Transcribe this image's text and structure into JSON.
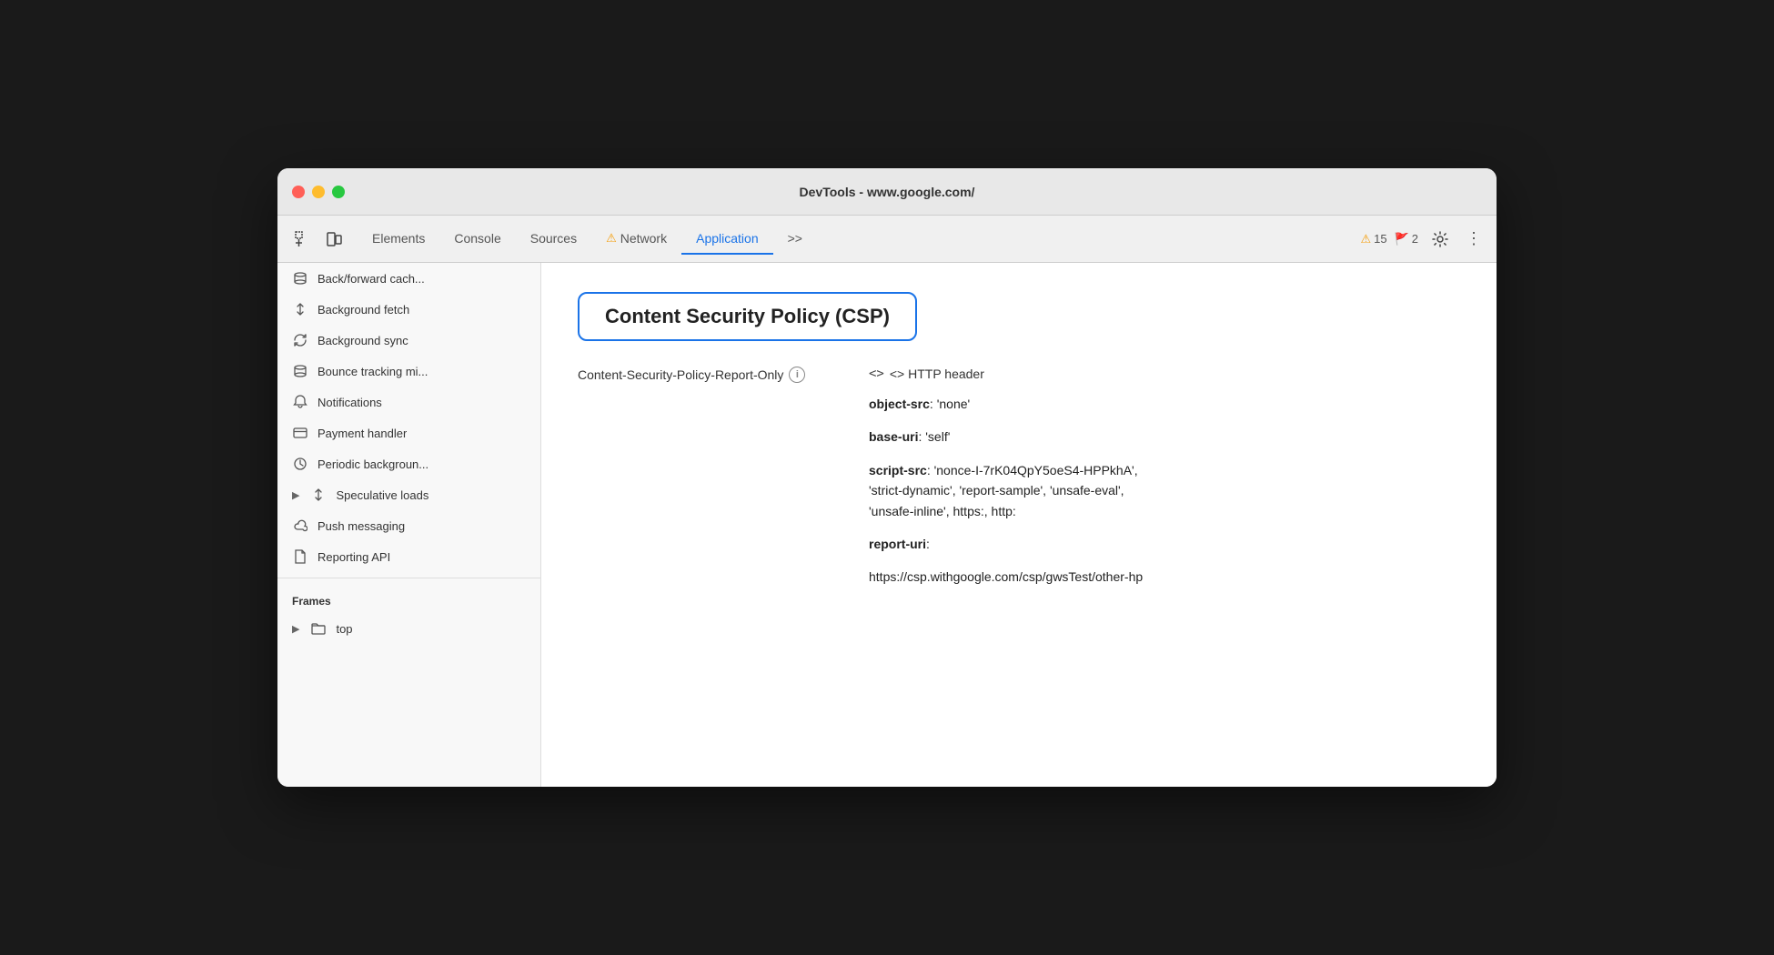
{
  "window": {
    "title": "DevTools - www.google.com/"
  },
  "toolbar": {
    "tabs": [
      {
        "id": "elements",
        "label": "Elements",
        "active": false,
        "warning": false
      },
      {
        "id": "console",
        "label": "Console",
        "active": false,
        "warning": false
      },
      {
        "id": "sources",
        "label": "Sources",
        "active": false,
        "warning": false
      },
      {
        "id": "network",
        "label": "Network",
        "active": false,
        "warning": true
      },
      {
        "id": "application",
        "label": "Application",
        "active": true,
        "warning": false
      }
    ],
    "more_label": ">>",
    "warning_count": "15",
    "error_count": "2"
  },
  "sidebar": {
    "items": [
      {
        "id": "back-forward-cache",
        "icon": "cylinder",
        "label": "Back/forward cache",
        "truncated": true
      },
      {
        "id": "background-fetch",
        "icon": "arrows-up-down",
        "label": "Background fetch"
      },
      {
        "id": "background-sync",
        "icon": "sync",
        "label": "Background sync"
      },
      {
        "id": "bounce-tracking",
        "icon": "cylinder",
        "label": "Bounce tracking mi",
        "truncated": true
      },
      {
        "id": "notifications",
        "icon": "bell",
        "label": "Notifications"
      },
      {
        "id": "payment-handler",
        "icon": "card",
        "label": "Payment handler"
      },
      {
        "id": "periodic-background",
        "icon": "clock",
        "label": "Periodic backgroun",
        "truncated": true
      },
      {
        "id": "speculative-loads",
        "icon": "arrows-up-down",
        "label": "Speculative loads",
        "expandable": true
      },
      {
        "id": "push-messaging",
        "icon": "cloud",
        "label": "Push messaging"
      },
      {
        "id": "reporting-api",
        "icon": "file",
        "label": "Reporting API"
      }
    ],
    "frames_section": "Frames",
    "frames_item": "top"
  },
  "content": {
    "csp_title": "Content Security Policy (CSP)",
    "policy_label": "Content-Security-Policy-Report-Only",
    "http_header_label": "<> HTTP header",
    "directives": [
      {
        "key": "object-src",
        "value": ": 'none'"
      },
      {
        "key": "base-uri",
        "value": ": 'self'"
      },
      {
        "key": "script-src",
        "value": ": 'nonce-I-7rK04QpY5oeS4-HPPkhA', 'strict-dynamic', 'report-sample', 'unsafe-eval', 'unsafe-inline', https:, http:"
      },
      {
        "key": "report-uri",
        "value": ":"
      },
      {
        "key": "report-uri-value",
        "value": "https://csp.withgoogle.com/csp/gwsTest/other-hp"
      }
    ]
  }
}
